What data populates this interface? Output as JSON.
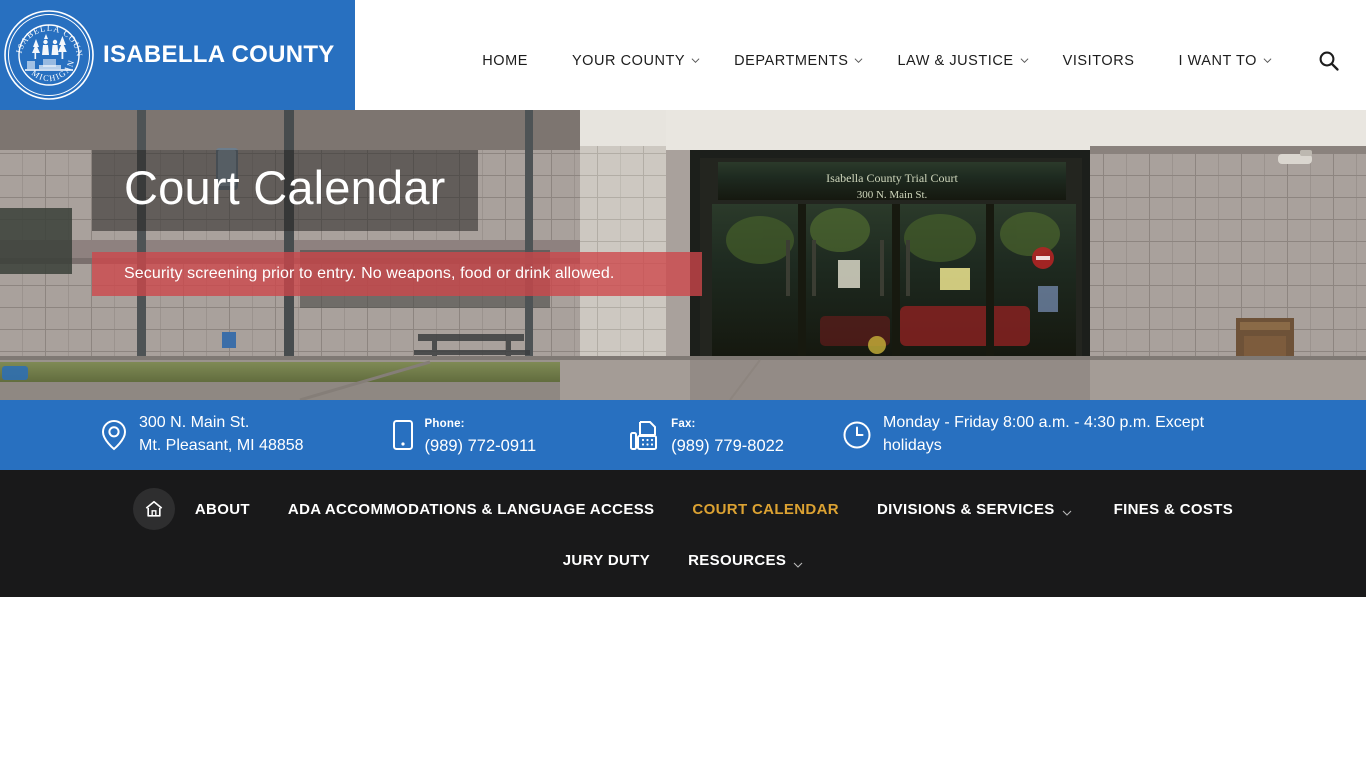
{
  "brand": {
    "name": "ISABELLA COUNTY",
    "seal_outer_text": "ISABELLA COUNTY",
    "seal_inner_text": "MICHIGAN",
    "bar_color": "#2870c0"
  },
  "main_nav": {
    "items": [
      {
        "label": "HOME",
        "has_caret": false
      },
      {
        "label": "YOUR COUNTY",
        "has_caret": true
      },
      {
        "label": "DEPARTMENTS",
        "has_caret": true
      },
      {
        "label": "LAW & JUSTICE",
        "has_caret": true
      },
      {
        "label": "VISITORS",
        "has_caret": false
      },
      {
        "label": "I WANT TO",
        "has_caret": true
      }
    ],
    "search_icon": "search-icon"
  },
  "hero": {
    "title": "Court Calendar",
    "alert": "Security screening prior to entry. No weapons, food or drink allowed.",
    "alert_color": "#ce464a",
    "photo_sign_line1": "Isabella County Trial Court",
    "photo_sign_line2": "300 N. Main St."
  },
  "contact": {
    "address_line1": "300 N. Main St.",
    "address_line2": "Mt. Pleasant, MI 48858",
    "phone_label": "Phone:",
    "phone_value": "(989) 772-0911",
    "fax_label": "Fax:",
    "fax_value": "(989) 779-8022",
    "hours": "Monday - Friday 8:00 a.m. - 4:30 p.m. Except holidays"
  },
  "section_nav": {
    "home_icon": "home-icon",
    "active_color": "#dca232",
    "row1": [
      {
        "label": "ABOUT",
        "has_caret": false,
        "active": false
      },
      {
        "label": "ADA ACCOMMODATIONS & LANGUAGE ACCESS",
        "has_caret": false,
        "active": false
      },
      {
        "label": "COURT CALENDAR",
        "has_caret": false,
        "active": true
      },
      {
        "label": "DIVISIONS & SERVICES",
        "has_caret": true,
        "active": false
      },
      {
        "label": "FINES & COSTS",
        "has_caret": false,
        "active": false
      }
    ],
    "row2": [
      {
        "label": "JURY DUTY",
        "has_caret": false,
        "active": false
      },
      {
        "label": "RESOURCES",
        "has_caret": true,
        "active": false
      }
    ]
  }
}
